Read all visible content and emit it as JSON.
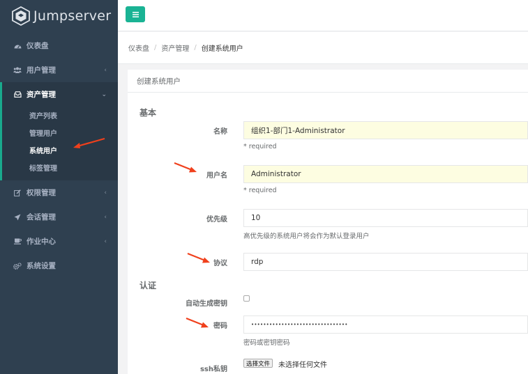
{
  "app": {
    "name": "Jumpserver",
    "accent": "#1ab394",
    "sidebar_bg": "#2f4050"
  },
  "topbar": {
    "menu_icon": "hamburger-icon"
  },
  "sidebar": {
    "items": [
      {
        "label": "仪表盘",
        "icon": "dashboard-icon"
      },
      {
        "label": "用户管理",
        "icon": "users-icon",
        "chevron": "‹"
      },
      {
        "label": "资产管理",
        "icon": "inbox-icon",
        "chevron": "⌄"
      },
      {
        "label": "权限管理",
        "icon": "edit-icon",
        "chevron": "‹"
      },
      {
        "label": "会话管理",
        "icon": "rocket-icon",
        "chevron": "‹"
      },
      {
        "label": "作业中心",
        "icon": "coffee-icon",
        "chevron": "‹"
      },
      {
        "label": "系统设置",
        "icon": "gears-icon"
      }
    ],
    "asset_sub": [
      {
        "label": "资产列表"
      },
      {
        "label": "管理用户"
      },
      {
        "label": "系统用户"
      },
      {
        "label": "标签管理"
      }
    ]
  },
  "breadcrumb": {
    "items": [
      "仪表盘",
      "资产管理",
      "创建系统用户"
    ],
    "separator": "/"
  },
  "panel": {
    "title": "创建系统用户",
    "sections": {
      "basic": "基本",
      "auth": "认证"
    },
    "fields": {
      "name": {
        "label": "名称",
        "value": "组织1-部门1-Administrator",
        "help": "* required"
      },
      "username": {
        "label": "用户名",
        "value": "Administrator",
        "help": "* required"
      },
      "priority": {
        "label": "优先级",
        "value": "10",
        "help": "高优先级的系统用户将会作为默认登录用户"
      },
      "protocol": {
        "label": "协议",
        "value": "rdp"
      },
      "auto_key": {
        "label": "自动生成密钥"
      },
      "password": {
        "label": "密码",
        "value": "••••••••••••••••••••••••••••••••",
        "help": "密码或密钥密码"
      },
      "ssh_key": {
        "label": "ssh私钥",
        "button": "选择文件",
        "status": "未选择任何文件"
      }
    }
  },
  "annotation_color": "#f0401c"
}
